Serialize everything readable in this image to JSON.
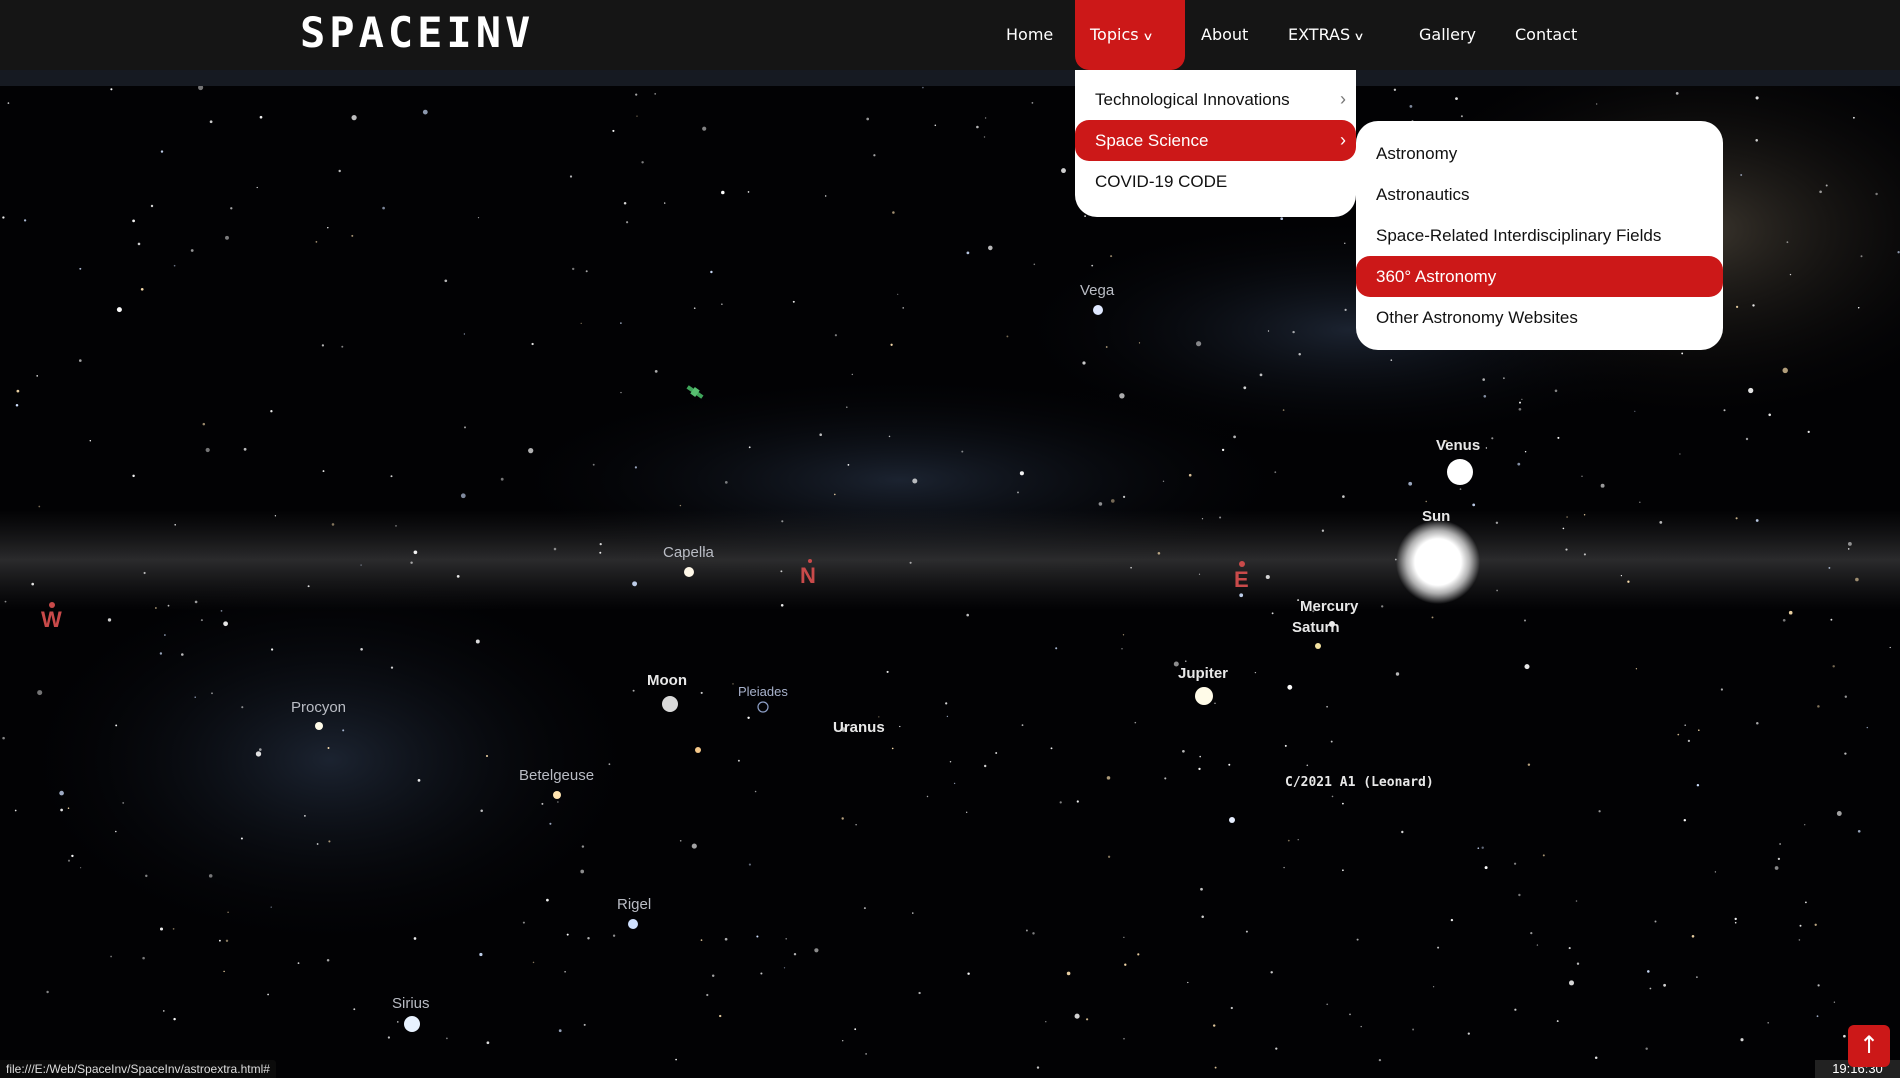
{
  "brand": {
    "logo": "SPACEINV"
  },
  "nav": {
    "items": [
      {
        "label": "Home"
      },
      {
        "label": "Topics",
        "has_caret": true
      },
      {
        "label": "About"
      },
      {
        "label": "EXTRAS",
        "has_caret": true
      },
      {
        "label": "Gallery"
      },
      {
        "label": "Contact"
      }
    ],
    "active": "Topics"
  },
  "topics_menu": {
    "items": [
      {
        "label": "Technological Innovations"
      },
      {
        "label": "Space Science"
      },
      {
        "label": "COVID-19 CODE"
      }
    ],
    "highlighted": "Space Science"
  },
  "space_science_submenu": {
    "items": [
      {
        "label": "Astronomy"
      },
      {
        "label": "Astronautics"
      },
      {
        "label": "Space-Related Interdisciplinary Fields"
      },
      {
        "label": "360° Astronomy"
      },
      {
        "label": "Other Astronomy Websites"
      }
    ],
    "highlighted": "360° Astronomy"
  },
  "sky": {
    "objects": {
      "vega": "Vega",
      "venus": "Venus",
      "sun": "Sun",
      "capella": "Capella",
      "mercury": "Mercury",
      "saturn": "Saturn",
      "jupiter": "Jupiter",
      "moon": "Moon",
      "pleiades": "Pleiades",
      "uranus": "Uranus",
      "procyon": "Procyon",
      "betelgeuse": "Betelgeuse",
      "comet": "C/2021 A1 (Leonard)",
      "rigel": "Rigel",
      "sirius": "Sirius"
    },
    "compass": {
      "w": "W",
      "n": "N",
      "e": "E"
    }
  },
  "status_bar": {
    "url": "file:///E:/Web/SpaceInv/SpaceInv/astroextra.html#"
  },
  "clock": {
    "time": "19:16:30"
  },
  "icons": {
    "scroll_top": "arrow-up-icon",
    "submenu_arrow": "chevron-right-icon",
    "nav_caret": "chevron-down-icon"
  },
  "colors": {
    "accent": "#cc1818",
    "navbar": "#151515",
    "dropdown": "#ffffff"
  }
}
